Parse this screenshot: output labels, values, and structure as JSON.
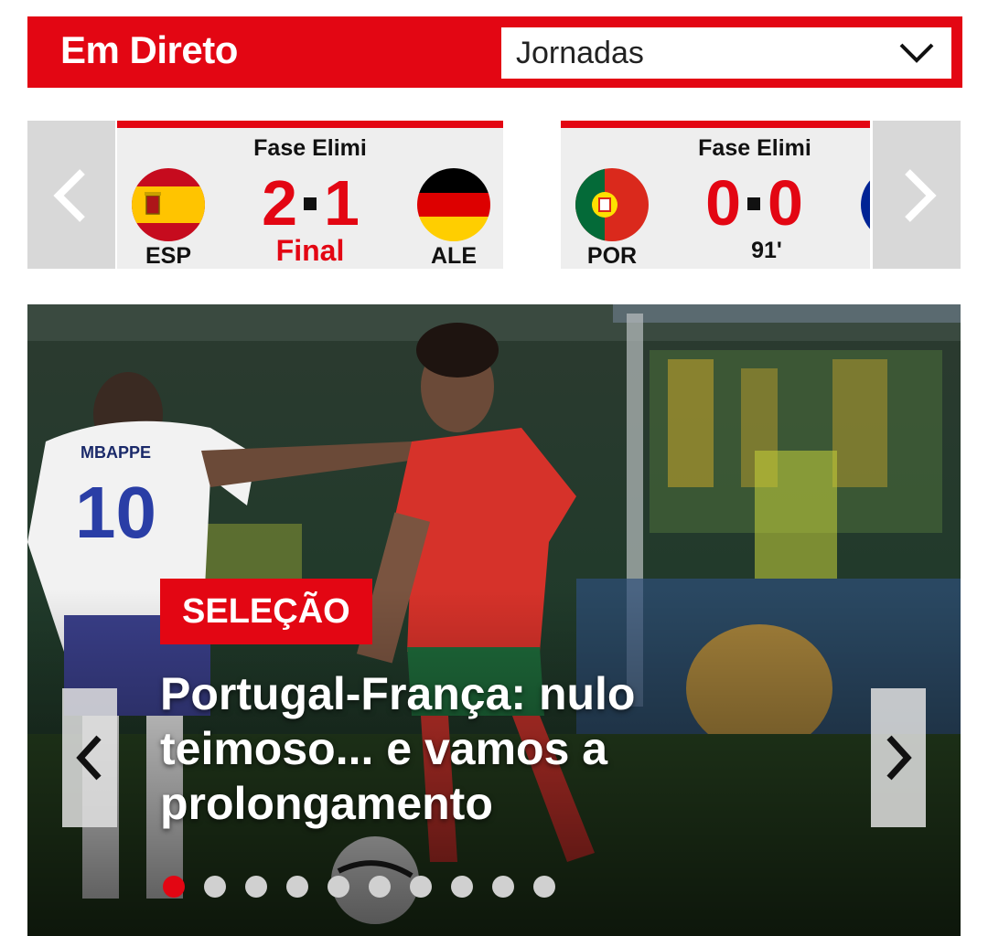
{
  "header": {
    "title": "Em Direto",
    "rounds_select": "Jornadas"
  },
  "scores": {
    "matches": [
      {
        "phase": "Fase Elimi",
        "home_code": "ESP",
        "away_code": "ALE",
        "home_score": "2",
        "away_score": "1",
        "status": "Final"
      },
      {
        "phase": "Fase Elimi",
        "home_code": "POR",
        "away_code": "",
        "home_score": "0",
        "away_score": "0",
        "status": "91'"
      }
    ]
  },
  "hero": {
    "category": "SELEÇÃO",
    "headline": "Portugal-França: nulo teimoso... e vamos a prolongamento",
    "slide_count": 10,
    "active_slide": 1
  },
  "colors": {
    "accent": "#e30613",
    "strip_bg": "#eeeeee",
    "arrow_bg": "#d8d8d8"
  },
  "icons": [
    "chevron-down-icon",
    "chevron-left-icon",
    "chevron-right-icon",
    "flag-spain-icon",
    "flag-germany-icon",
    "flag-portugal-icon",
    "flag-france-icon"
  ]
}
